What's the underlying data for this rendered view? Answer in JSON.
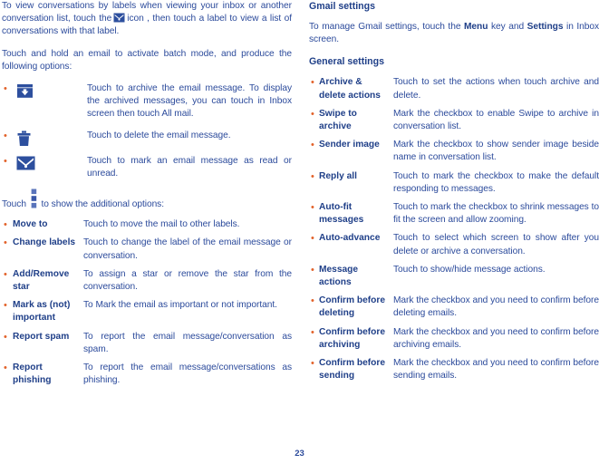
{
  "page": {
    "number": "23",
    "colors": {
      "text_blue": "#2b4a9b",
      "heading_blue": "#1f3f88",
      "bullet_orange": "#e2622a",
      "icon_blue": "#2d4f9e"
    }
  },
  "left_column": {
    "intro_paragraph": {
      "part1": "To view conversations by labels when viewing your inbox or another conversation list, touch the",
      "icon": "labels-envelope-icon",
      "part2": "icon , then touch a label to view a list of conversations with that label."
    },
    "batch_paragraph": "Touch and hold an email to activate batch mode, and produce the following options:",
    "icon_options": [
      {
        "icon": "archive-icon",
        "description": "Touch to archive the email message. To display the archived messages, you can touch in Inbox screen then touch All mail."
      },
      {
        "icon": "trash-delete-icon",
        "description": "Touch to delete the email message."
      },
      {
        "icon": "envelope-mark-read-icon",
        "description": "Touch to mark an email message as read or unread."
      }
    ],
    "additional_paragraph": {
      "part1": "Touch",
      "icon": "more-options-menu-icon",
      "part2": "to show the additional options:"
    },
    "additional_options": [
      {
        "term": "Move to",
        "description": "Touch to move the mail to other labels."
      },
      {
        "term": "Change labels",
        "description": "Touch to change the label of the email message or conversation."
      },
      {
        "term": "Add/Remove star",
        "description": "To assign a star or remove the star from the conversation."
      },
      {
        "term": "Mark as (not) important",
        "description": "To Mark the email as important or not important."
      },
      {
        "term": "Report spam",
        "description": "To report the email message/conversation as spam."
      },
      {
        "term": "Report phishing",
        "description": "To report the email message/conversations as phishing."
      }
    ]
  },
  "right_column": {
    "section_heading": "Gmail settings",
    "intro": {
      "part1": "To manage Gmail settings, touch the",
      "bold1": "Menu",
      "part2": "key and",
      "bold2": "Settings",
      "part3": "in Inbox screen."
    },
    "general_heading": "General settings",
    "settings": [
      {
        "term": "Archive & delete actions",
        "description": "Touch to set the actions when touch archive and delete."
      },
      {
        "term": "Swipe to archive",
        "description": "Mark the checkbox to enable Swipe to archive in conversation list."
      },
      {
        "term": "Sender image",
        "description": "Mark the checkbox to show sender image beside name in conversation list."
      },
      {
        "term": "Reply all",
        "description": "Touch to mark the checkbox to make the default responding to messages."
      },
      {
        "term": "Auto-fit messages",
        "description": "Touch to mark the checkbox to shrink messages to fit the screen and allow zooming."
      },
      {
        "term": "Auto-advance",
        "description": "Touch to select which screen to show after you delete or archive a conversation."
      },
      {
        "term": "Message actions",
        "description": "Touch to show/hide message actions."
      },
      {
        "term": "Confirm before deleting",
        "description": "Mark the checkbox and you need to confirm before deleting emails."
      },
      {
        "term": "Confirm before archiving",
        "description": "Mark the checkbox and you need to confirm before archiving emails."
      },
      {
        "term": "Confirm before sending",
        "description": "Mark the checkbox and you need to confirm before sending emails."
      }
    ]
  }
}
